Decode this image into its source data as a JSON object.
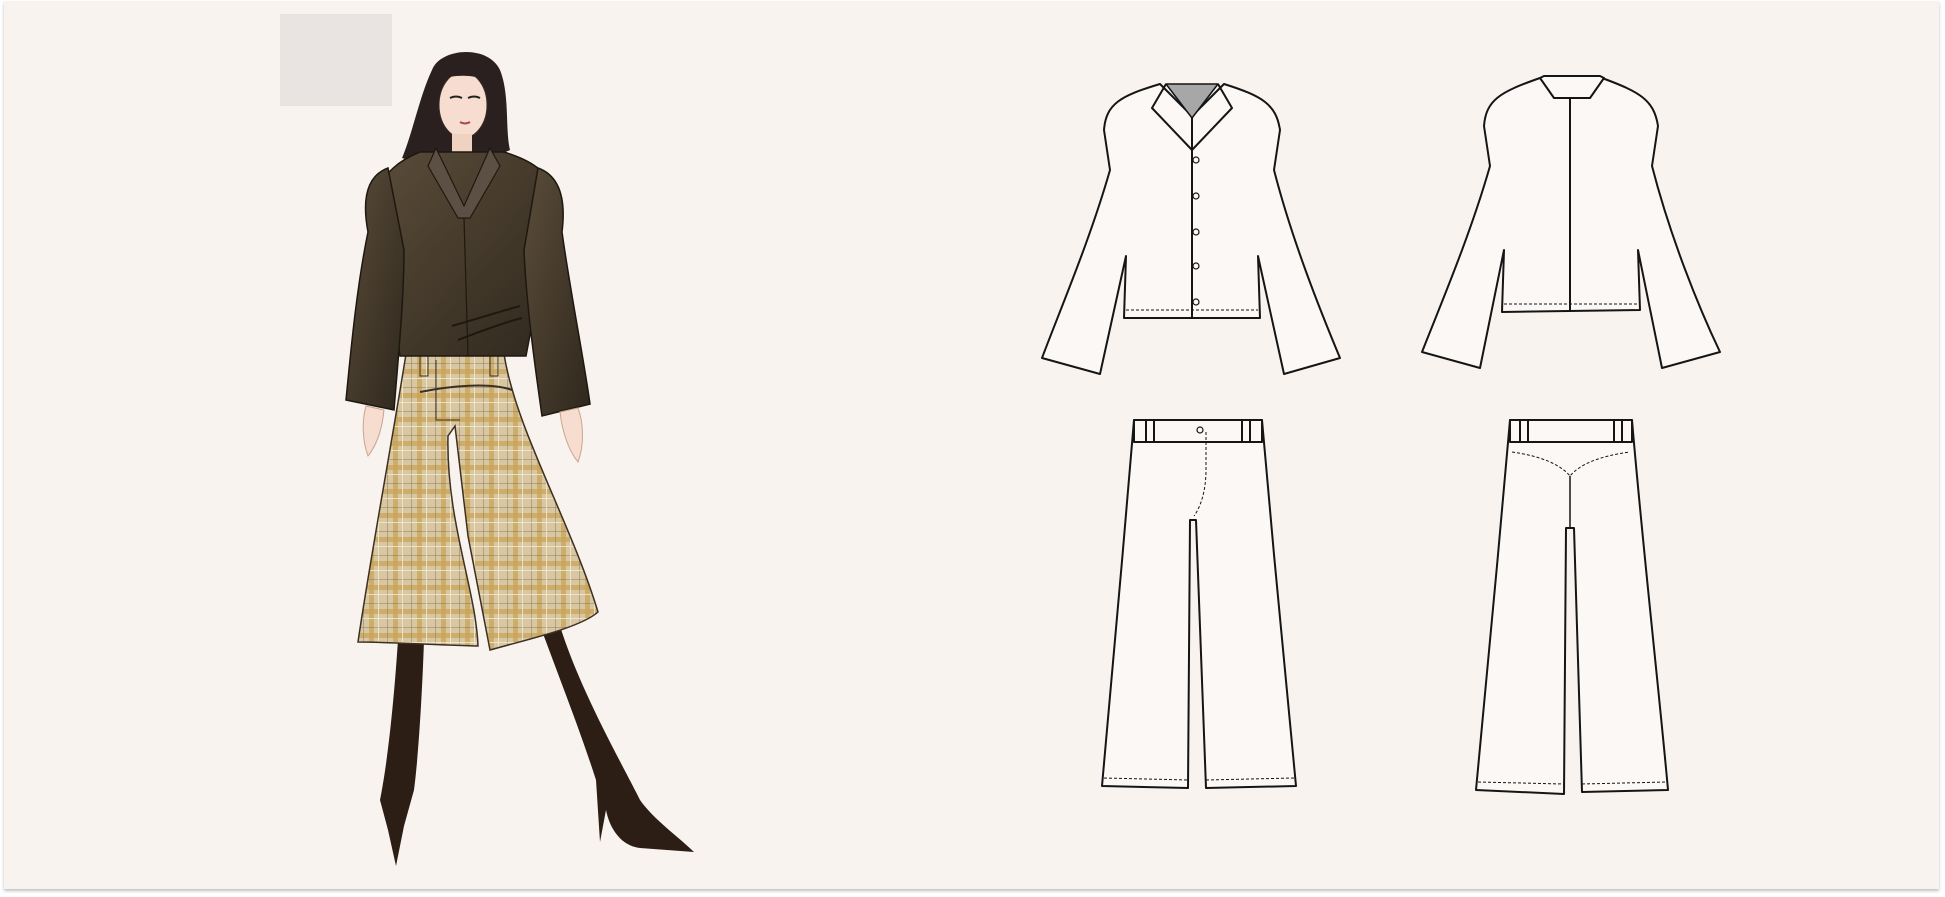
{
  "board": {
    "background": "#f8f3ef",
    "swatch_color": "#e9e3e1"
  },
  "illustration": {
    "jacket_color": "#463b2c",
    "plaid_base": "#d6c29a",
    "plaid_line": "#c49c45",
    "stocking_color": "#2c1e14",
    "hair_color": "#2a2020",
    "skin_color": "#f6ddcf"
  },
  "flats": {
    "line_color": "#151515",
    "fill": "#fbf8f5",
    "views": [
      "shirt-front",
      "shirt-back",
      "trousers-front",
      "trousers-back"
    ]
  }
}
